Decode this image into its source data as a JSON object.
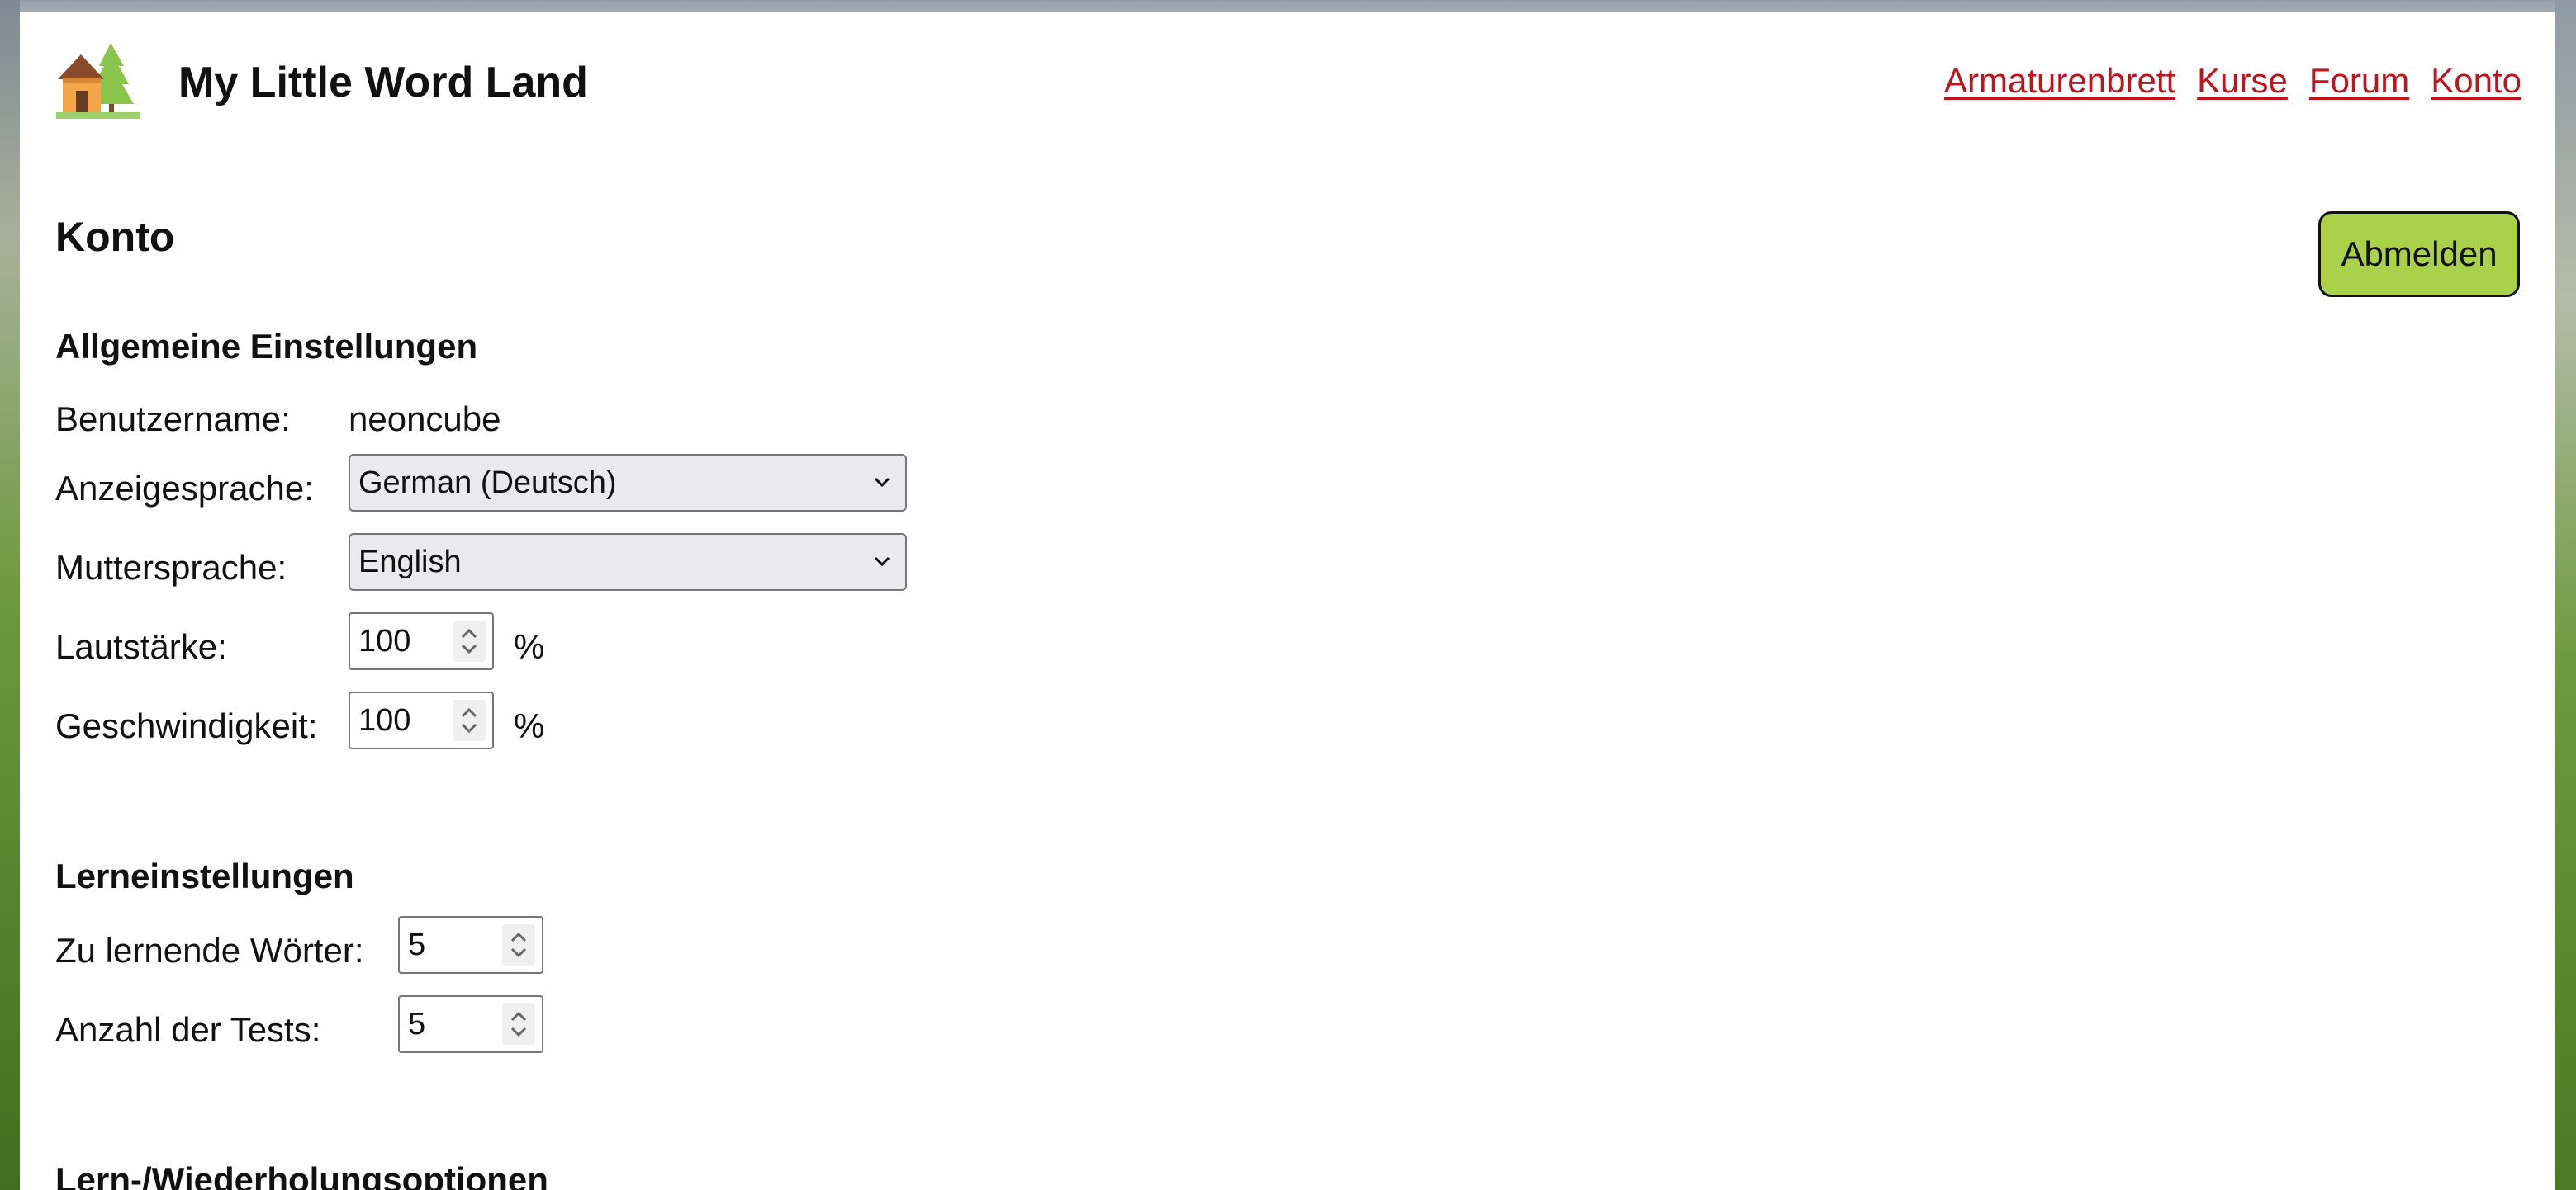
{
  "app": {
    "title": "My Little Word Land",
    "logo_icon": "house-with-tree-icon"
  },
  "nav": {
    "items": [
      "Armaturenbrett",
      "Kurse",
      "Forum",
      "Konto"
    ],
    "link_color": "#c0141b"
  },
  "page": {
    "title": "Konto",
    "logout_label": "Abmelden",
    "logout_color": "#a9d14a"
  },
  "general": {
    "title": "Allgemeine Einstellungen",
    "username_label": "Benutzername:",
    "username_value": "neoncube",
    "display_lang_label": "Anzeigesprache:",
    "display_lang_value": "German (Deutsch)",
    "native_lang_label": "Muttersprache:",
    "native_lang_value": "English",
    "volume_label": "Lautstärke:",
    "volume_value": "100",
    "volume_unit": "%",
    "speed_label": "Geschwindigkeit:",
    "speed_value": "100",
    "speed_unit": "%"
  },
  "learning": {
    "title": "Lerneinstellungen",
    "words_label": "Zu lernende Wörter:",
    "words_value": "5",
    "tests_label": "Anzahl der Tests:",
    "tests_value": "5"
  },
  "review": {
    "title": "Lern-/Wiederholungsoptionen"
  }
}
